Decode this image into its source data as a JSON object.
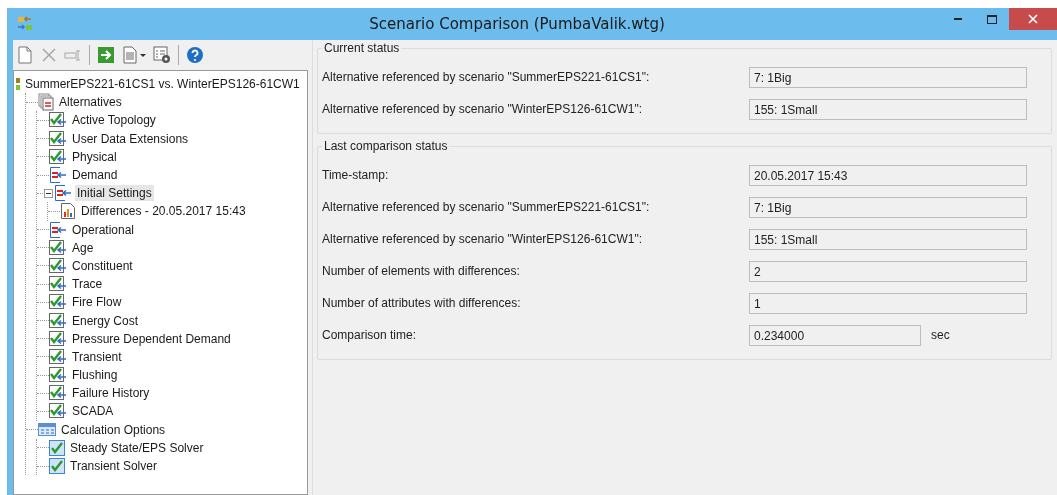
{
  "window": {
    "title": "Scenario Comparison (PumbaValik.wtg)"
  },
  "toolbar": [
    {
      "kind": "new",
      "disabled": false
    },
    {
      "kind": "delete",
      "disabled": true
    },
    {
      "kind": "rename",
      "disabled": true
    },
    {
      "kind": "separator"
    },
    {
      "kind": "run",
      "disabled": false
    },
    {
      "kind": "report",
      "disabled": false
    },
    {
      "kind": "options",
      "disabled": false
    },
    {
      "kind": "separator"
    },
    {
      "kind": "help",
      "disabled": false
    }
  ],
  "tree": [
    {
      "label": "SummerEPS221-61CS1 vs. WinterEPS126-61CW1",
      "kind": "comparison",
      "selected": false,
      "children": [
        {
          "label": "Alternatives",
          "kind": "alternatives",
          "selected": false,
          "children": [
            {
              "label": "Active Topology",
              "kind": "same",
              "selected": false
            },
            {
              "label": "User Data Extensions",
              "kind": "same",
              "selected": false
            },
            {
              "label": "Physical",
              "kind": "same",
              "selected": false
            },
            {
              "label": "Demand",
              "kind": "differs",
              "selected": false
            },
            {
              "label": "Initial Settings",
              "kind": "differs",
              "selected": true,
              "expanded": true,
              "children": [
                {
                  "label": "Differences - 20.05.2017 15:43",
                  "kind": "result",
                  "selected": false
                }
              ]
            },
            {
              "label": "Operational",
              "kind": "differs",
              "selected": false
            },
            {
              "label": "Age",
              "kind": "same",
              "selected": false
            },
            {
              "label": "Constituent",
              "kind": "same",
              "selected": false
            },
            {
              "label": "Trace",
              "kind": "same",
              "selected": false
            },
            {
              "label": "Fire Flow",
              "kind": "same",
              "selected": false
            },
            {
              "label": "Energy Cost",
              "kind": "same",
              "selected": false
            },
            {
              "label": "Pressure Dependent Demand",
              "kind": "same",
              "selected": false
            },
            {
              "label": "Transient",
              "kind": "same",
              "selected": false
            },
            {
              "label": "Flushing",
              "kind": "same",
              "selected": false
            },
            {
              "label": "Failure History",
              "kind": "same",
              "selected": false
            },
            {
              "label": "SCADA",
              "kind": "same",
              "selected": false
            }
          ]
        },
        {
          "label": "Calculation Options",
          "kind": "calc-options",
          "selected": false,
          "children": [
            {
              "label": "Steady State/EPS Solver",
              "kind": "solver",
              "selected": false
            },
            {
              "label": "Transient Solver",
              "kind": "solver",
              "selected": false
            }
          ]
        }
      ]
    }
  ],
  "groups": [
    {
      "title": "Current status",
      "rows": [
        {
          "label": "Alternative referenced by scenario \"SummerEPS221-61CS1\":",
          "value": "7: 1Big"
        },
        {
          "label": "Alternative referenced by scenario \"WinterEPS126-61CW1\":",
          "value": "155: 1Small"
        }
      ]
    },
    {
      "title": "Last comparison status",
      "rows": [
        {
          "label": "Time-stamp:",
          "value": "20.05.2017 15:43"
        },
        {
          "label": "Alternative referenced by scenario \"SummerEPS221-61CS1\":",
          "value": "7: 1Big"
        },
        {
          "label": "Alternative referenced by scenario \"WinterEPS126-61CW1\":",
          "value": "155: 1Small"
        },
        {
          "label": "Number of elements with differences:",
          "value": "2"
        },
        {
          "label": "Number of attributes with differences:",
          "value": "1"
        },
        {
          "label": "Comparison time:",
          "value": "0.234000",
          "unit": "sec"
        }
      ]
    }
  ]
}
